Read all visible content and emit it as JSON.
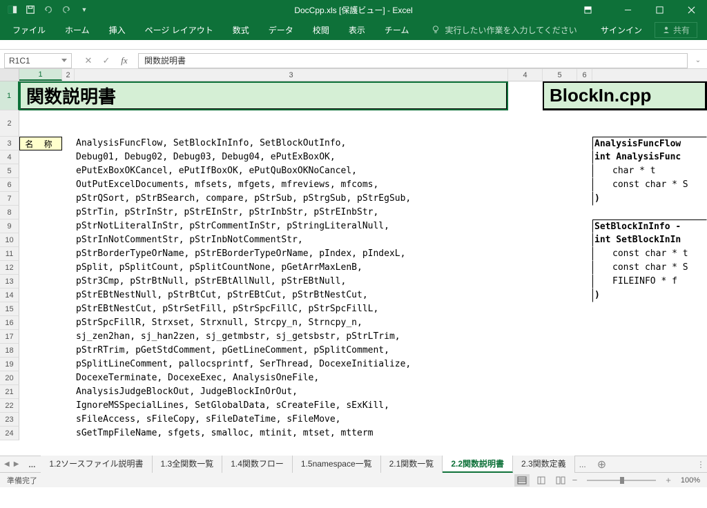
{
  "titlebar": {
    "title": "DocCpp.xls  [保護ビュー] - Excel"
  },
  "ribbon": {
    "tabs": [
      "ファイル",
      "ホーム",
      "挿入",
      "ページ レイアウト",
      "数式",
      "データ",
      "校閲",
      "表示",
      "チーム"
    ],
    "tellme": "実行したい作業を入力してください",
    "signin": "サインイン",
    "share": "共有"
  },
  "formulabar": {
    "namebox": "R1C1",
    "value": "関数説明書"
  },
  "columns": [
    "1",
    "2",
    "3",
    "4",
    "5",
    "6"
  ],
  "row_headers": [
    "1",
    "2",
    "3",
    "4",
    "5",
    "6",
    "7",
    "8",
    "9",
    "10",
    "11",
    "12",
    "13",
    "14",
    "15",
    "16",
    "17",
    "18",
    "19",
    "20",
    "21",
    "22",
    "23",
    "24"
  ],
  "headers": {
    "left": "関数説明書",
    "right": "BlockIn.cpp",
    "name_label": "名 称"
  },
  "lines": [
    "AnalysisFuncFlow, SetBlockInInfo, SetBlockOutInfo,",
    "Debug01, Debug02, Debug03, Debug04, ePutExBoxOK,",
    "ePutExBoxOKCancel, ePutIfBoxOK, ePutQuBoxOKNoCancel,",
    "OutPutExcelDocuments, mfsets, mfgets, mfreviews, mfcoms,",
    "pStrQSort, pStrBSearch, compare, pStrSub, pStrgSub, pStrEgSub,",
    "pStrTin, pStrInStr, pStrEInStr, pStrInbStr, pStrEInbStr,",
    "pStrNotLiteralInStr, pStrCommentInStr, pStringLiteralNull,",
    "pStrInNotCommentStr, pStrInbNotCommentStr,",
    "pStrBorderTypeOrName, pStrEBorderTypeOrName, pIndex, pIndexL,",
    "pSplit, pSplitCount, pSplitCountNone, pGetArrMaxLenB,",
    "pStr3Cmp, pStrBtNull, pStrEBtAllNull, pStrEBtNull,",
    "pStrEBtNestNull, pStrBtCut, pStrEBtCut, pStrBtNestCut,",
    "pStrEBtNestCut, pStrSetFill, pStrSpcFillC, pStrSpcFillL,",
    "pStrSpcFillR, Strxset, Strxnull, Strcpy_n, Strncpy_n,",
    "sj_zen2han, sj_han2zen, sj_getmbstr, sj_getsbstr, pStrLTrim,",
    "pStrRTrim, pGetStdComment, pGetLineComment, pSplitComment,",
    "pSplitLineComment, pallocsprintf, SerThread, DocexeInitialize,",
    "DocexeTerminate, DocexeExec, AnalysisOneFile,",
    "AnalysisJudgeBlockOut, JudgeBlockInOrOut,",
    "IgnoreMSSpecialLines, SetGlobalData, sCreateFile, sExKill,",
    "sFileAccess, sFileCopy, sFileDateTime, sFileMove,",
    "sGetTmpFileName, sfgets, smalloc, mtinit, mtset, mtterm"
  ],
  "right_block1": [
    "AnalysisFuncFlow",
    "int AnalysisFunc",
    "char *         t",
    "const char * S",
    ")"
  ],
  "right_block2": [
    "SetBlockInInfo -",
    "int SetBlockInIn",
    "const char * t",
    "const char * S",
    "FILEINFO *   f",
    ")"
  ],
  "sheets": {
    "tabs": [
      "1.2ソースファイル説明書",
      "1.3全関数一覧",
      "1.4関数フロー",
      "1.5namespace一覧",
      "2.1関数一覧",
      "2.2関数説明書",
      "2.3関数定義"
    ],
    "active": 5
  },
  "status": {
    "left": "準備完了",
    "zoom": "100%"
  }
}
